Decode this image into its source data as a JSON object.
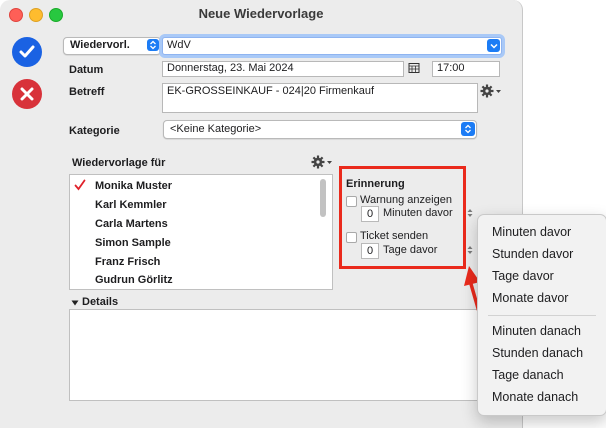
{
  "window": {
    "title": "Neue Wiedervorlage"
  },
  "actions": {
    "ok_icon": "checkmark-icon",
    "cancel_icon": "x-icon"
  },
  "header": {
    "type_popup": "Wiedervorl.",
    "wdv_value": "WdV"
  },
  "form": {
    "datum_label": "Datum",
    "datum_value": "Donnerstag, 23. Mai 2024",
    "time_value": "17:00",
    "betreff_label": "Betreff",
    "betreff_value": "EK-GROSSEINKAUF - 024|20 Firmenkauf",
    "kategorie_label": "Kategorie",
    "kategorie_value": "<Keine Kategorie>"
  },
  "recipients": {
    "label": "Wiedervorlage für",
    "items": [
      {
        "name": "Monika Muster",
        "checked": true
      },
      {
        "name": "Karl Kemmler",
        "checked": false
      },
      {
        "name": "Carla Martens",
        "checked": false
      },
      {
        "name": "Simon Sample",
        "checked": false
      },
      {
        "name": "Franz Frisch",
        "checked": false
      },
      {
        "name": "Gudrun Görlitz",
        "checked": false
      }
    ]
  },
  "reminder": {
    "title": "Erinnerung",
    "warning_label": "Warnung anzeigen",
    "warning_value": "0",
    "warning_unit": "Minuten davor",
    "ticket_label": "Ticket senden",
    "ticket_value": "0",
    "ticket_unit": "Tage davor"
  },
  "details": {
    "label": "Details"
  },
  "menu": {
    "items_before": [
      "Minuten davor",
      "Stunden davor",
      "Tage davor",
      "Monate davor"
    ],
    "items_after": [
      "Minuten danach",
      "Stunden danach",
      "Tage danach",
      "Monate danach"
    ]
  },
  "colors": {
    "accent": "#1a62e3",
    "cancel": "#d8323a",
    "highlight": "#ea2a1c",
    "check": "#e0212a"
  }
}
